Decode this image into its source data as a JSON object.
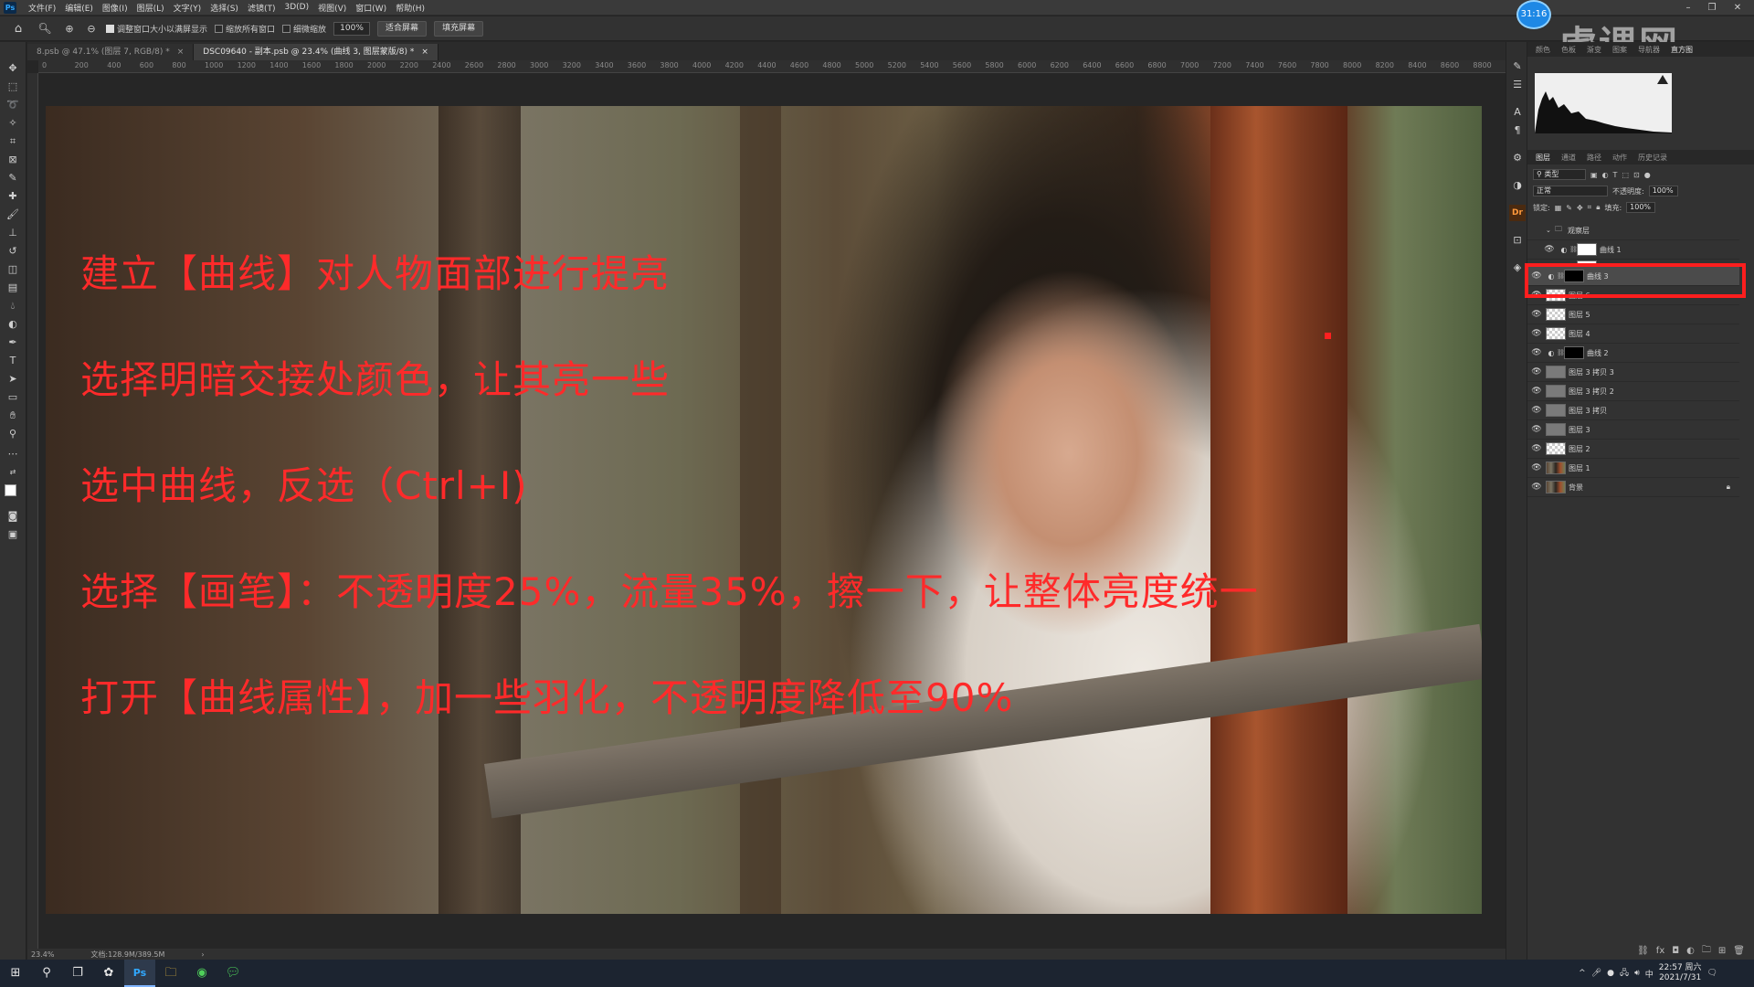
{
  "menubar": {
    "items": [
      "文件(F)",
      "编辑(E)",
      "图像(I)",
      "图层(L)",
      "文字(Y)",
      "选择(S)",
      "滤镜(T)",
      "3D(D)",
      "视图(V)",
      "窗口(W)",
      "帮助(H)"
    ]
  },
  "window_controls": {
    "minimize": "–",
    "restore": "❐",
    "close": "✕"
  },
  "options_bar": {
    "resize_windows": "调整窗口大小以满屏显示",
    "zoom_all_windows": "缩放所有窗口",
    "scrubby_zoom": "细微缩放",
    "zoom_value": "100%",
    "fit_screen": "适合屏幕",
    "fill_screen": "填充屏幕"
  },
  "doc_tabs": [
    {
      "label": "8.psb @ 47.1% (图层 7, RGB/8) *",
      "active": false
    },
    {
      "label": "DSC09640 - 副本.psb @ 23.4% (曲线 3, 图层蒙版/8) *",
      "active": true
    }
  ],
  "ruler": {
    "ticks": [
      "0",
      "200",
      "400",
      "600",
      "800",
      "1000",
      "1200",
      "1400",
      "1600",
      "1800",
      "2000",
      "2200",
      "2400",
      "2600",
      "2800",
      "3000",
      "3200",
      "3400",
      "3600",
      "3800",
      "4000",
      "4200",
      "4400",
      "4600",
      "4800",
      "5000",
      "5200",
      "5400",
      "5600",
      "5800",
      "6000",
      "6200",
      "6400",
      "6600",
      "6800",
      "7000",
      "7200",
      "7400",
      "7600",
      "7800",
      "8000",
      "8200",
      "8400",
      "8600",
      "8800"
    ]
  },
  "canvas": {
    "instructions": [
      "建立【曲线】对人物面部进行提亮",
      "选择明暗交接处颜色，让其亮一些",
      "选中曲线，反选（Ctrl+I)",
      "选择【画笔】：不透明度25%，流量35%，擦一下，让整体亮度统一",
      "打开【曲线属性】，加一些羽化，不透明度降低至90%"
    ],
    "instruction_color": "#ff2a2a"
  },
  "status_bar": {
    "zoom": "23.4%",
    "doc_size": "文档:128.9M/389.5M",
    "arrow": "›"
  },
  "timer": "31:16",
  "watermark": "虎课网",
  "top_panel_tabs": [
    "颜色",
    "色板",
    "渐变",
    "图案",
    "导航器",
    "直方图"
  ],
  "layers_panel": {
    "tabs": [
      "图层",
      "通道",
      "路径",
      "动作",
      "历史记录"
    ],
    "filter_kind": "类型",
    "blend_mode": "正常",
    "opacity_label": "不透明度:",
    "opacity_value": "100%",
    "lock_label": "锁定:",
    "fill_label": "填充:",
    "fill_value": "100%",
    "layers": [
      {
        "name": "观察层",
        "type": "group",
        "thumb": "none"
      },
      {
        "name": "曲线 1",
        "type": "adjustment",
        "thumb": "white"
      },
      {
        "name": "",
        "type": "adjustment",
        "thumb": "white"
      },
      {
        "name": "曲线 3",
        "type": "adjustment",
        "thumb": "black",
        "selected": true
      },
      {
        "name": "图层 6",
        "type": "pixel",
        "thumb": "trans"
      },
      {
        "name": "图层 5",
        "type": "pixel",
        "thumb": "trans"
      },
      {
        "name": "图层 4",
        "type": "pixel",
        "thumb": "trans"
      },
      {
        "name": "曲线 2",
        "type": "adjustment",
        "thumb": "black"
      },
      {
        "name": "图层 3 拷贝 3",
        "type": "pixel",
        "thumb": "gray"
      },
      {
        "name": "图层 3 拷贝 2",
        "type": "pixel",
        "thumb": "gray"
      },
      {
        "name": "图层 3 拷贝",
        "type": "pixel",
        "thumb": "gray"
      },
      {
        "name": "图层 3",
        "type": "pixel",
        "thumb": "gray"
      },
      {
        "name": "图层 2",
        "type": "pixel",
        "thumb": "trans"
      },
      {
        "name": "图层 1",
        "type": "pixel",
        "thumb": "photo"
      },
      {
        "name": "背景",
        "type": "background",
        "thumb": "photo",
        "locked": true
      }
    ],
    "highlight_color": "#ff1e1e"
  },
  "taskbar": {
    "clock_time": "22:57 周六",
    "clock_date": "2021/7/31",
    "ps_label": "Ps"
  }
}
